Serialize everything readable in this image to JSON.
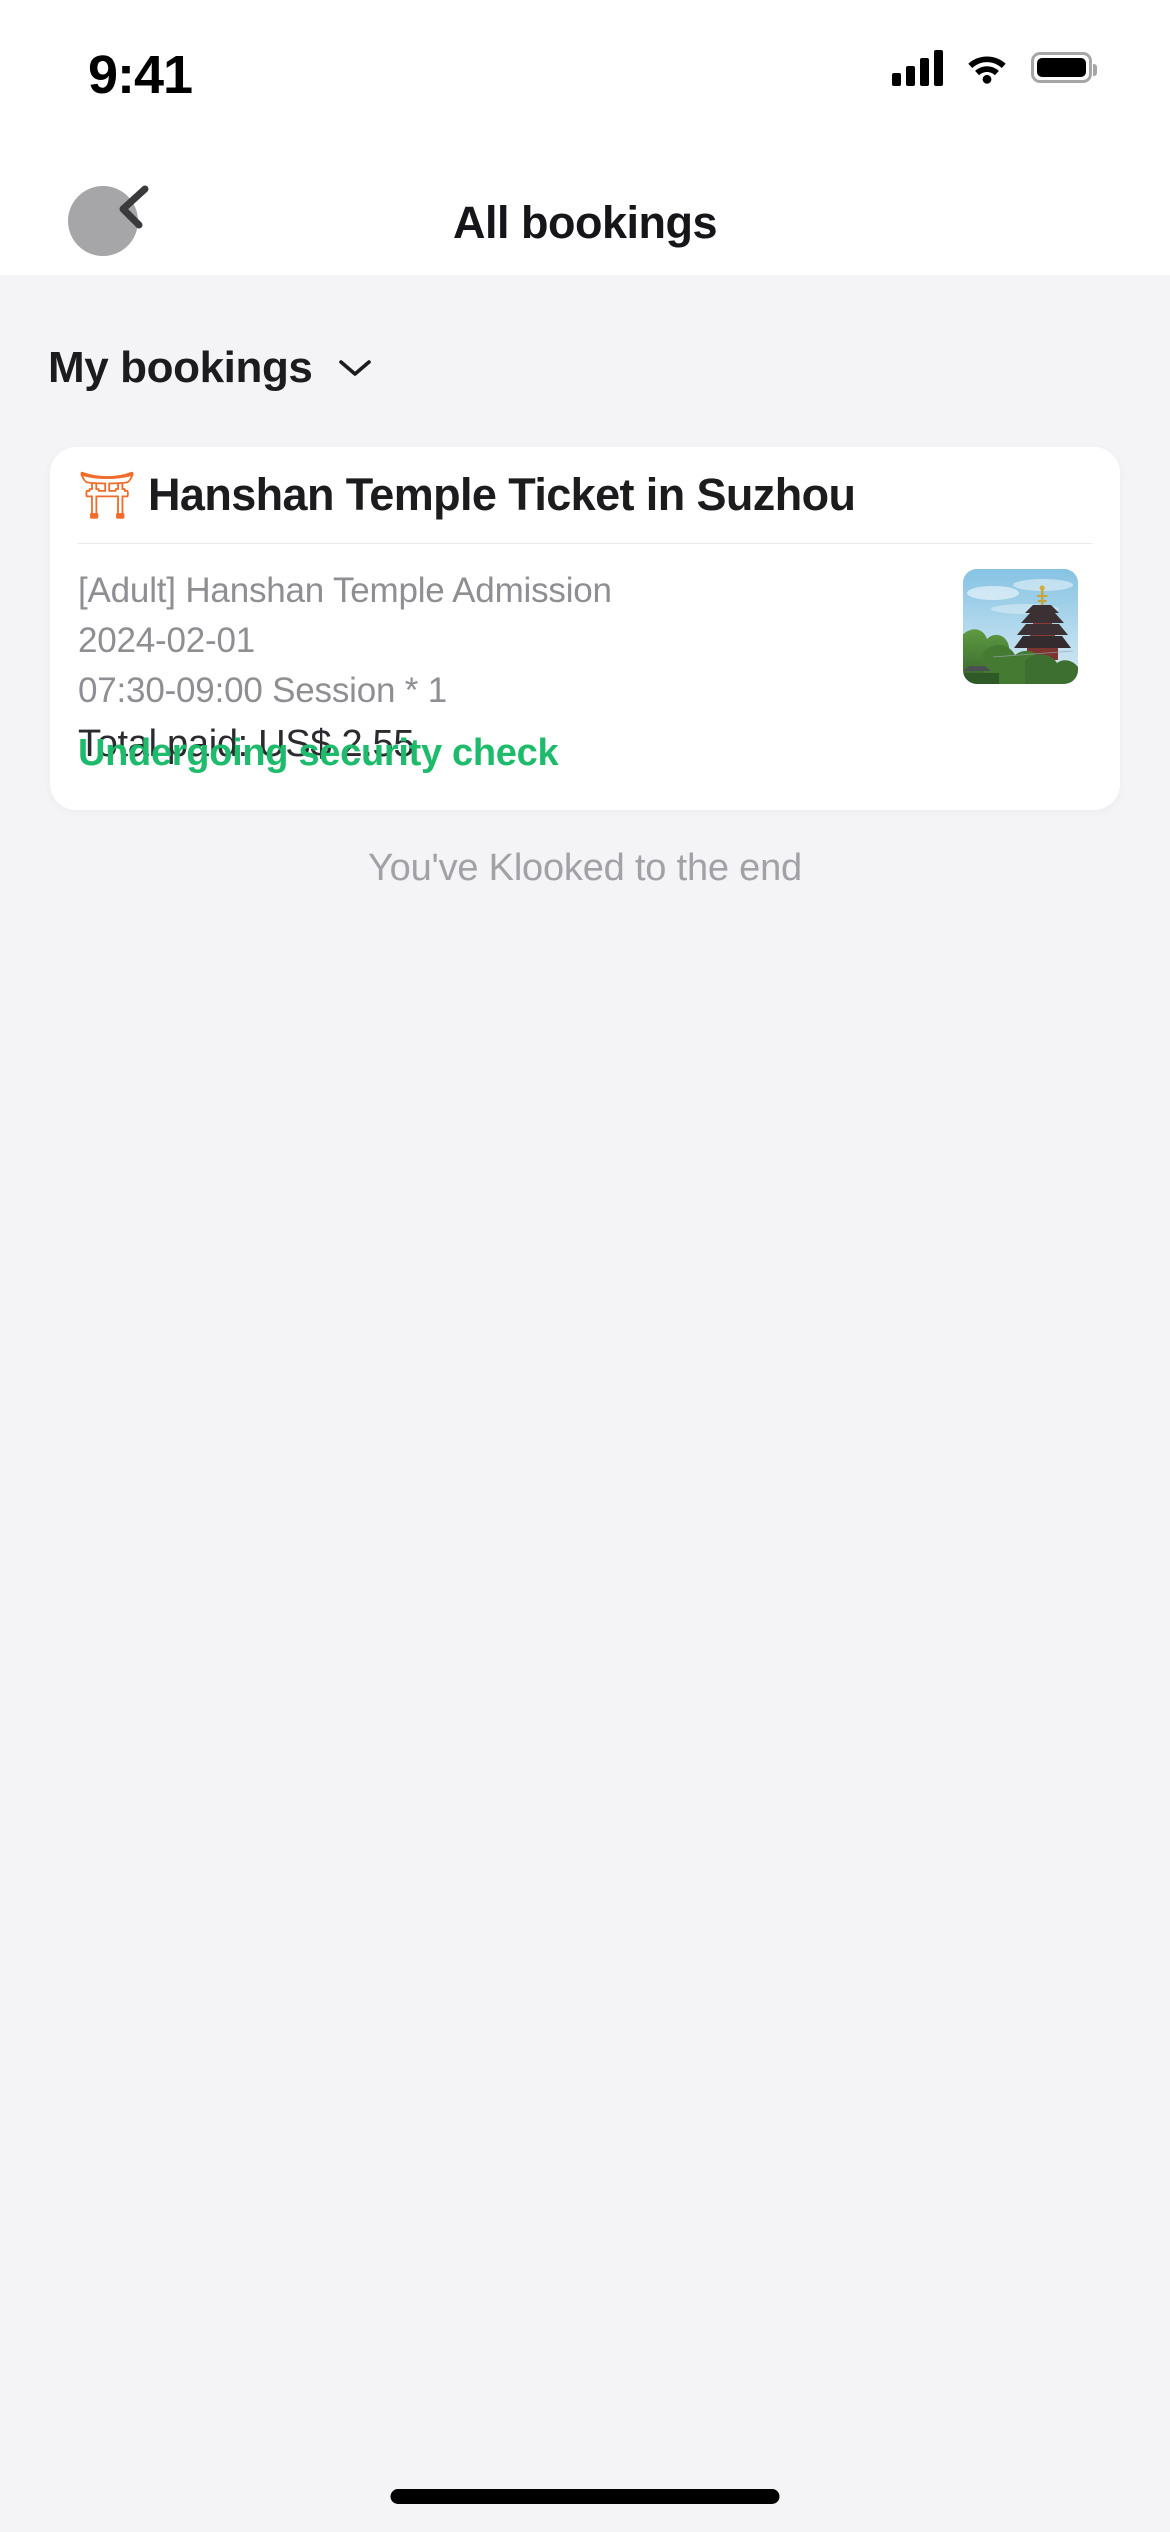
{
  "status_bar": {
    "time": "9:41",
    "cellular_icon": "signal-bars-icon",
    "wifi_icon": "wifi-icon",
    "battery_icon": "battery-full-icon"
  },
  "header": {
    "back_icon": "back-chevron-icon",
    "title": "All bookings"
  },
  "filter": {
    "label": "My bookings",
    "chevron_icon": "chevron-down-icon"
  },
  "booking_card": {
    "category_icon": "torii-gate-icon",
    "category_glyph": "⛩",
    "title": "Hanshan Temple Ticket in Suzhou",
    "detail_lines": [
      "[Adult] Hanshan Temple Admission",
      "2024-02-01",
      " 07:30-09:00 Session * 1"
    ],
    "total_paid": "Total paid: US$ 2.55",
    "status": "Undergoing security check",
    "thumbnail_alt": "pagoda-temple-photo"
  },
  "footer": {
    "end_of_list": "You've Klooked to the end"
  },
  "colors": {
    "page_background": "#f4f4f6",
    "card_background": "#ffffff",
    "status_green": "#1fbb6c",
    "torii_orange": "#ef6c2b",
    "muted_text": "#8e8e93",
    "primary_text": "#1c1c1e"
  }
}
